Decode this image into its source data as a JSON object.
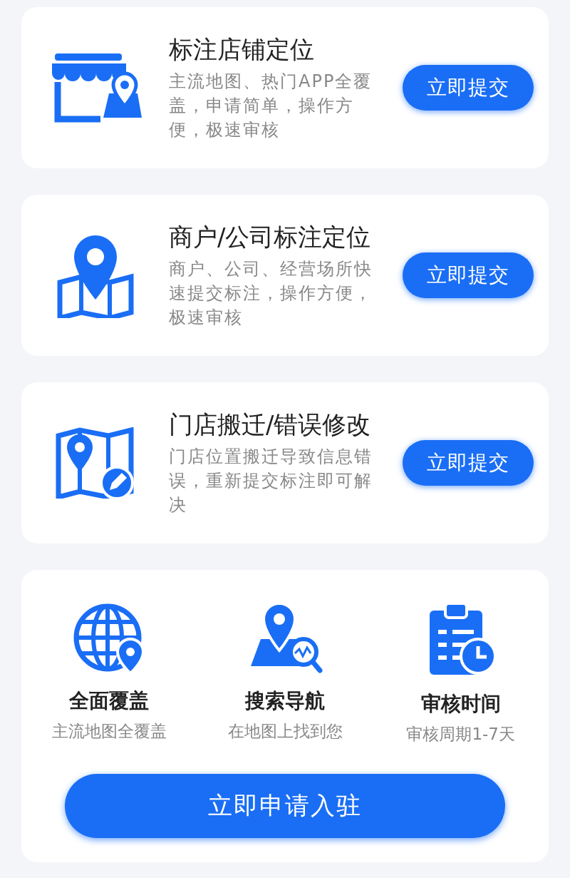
{
  "services": [
    {
      "kind": "shop",
      "title": "标注店铺定位",
      "description": "主流地图、热门APP全覆盖，申请简单，操作方便，极速审核",
      "button": "立即提交"
    },
    {
      "kind": "map-pin",
      "title": "商户/公司标注定位",
      "description": "商户、公司、经营场所快速提交标注，操作方便，极速审核",
      "button": "立即提交"
    },
    {
      "kind": "map-edit",
      "title": "门店搬迁/错误修改",
      "description": "门店位置搬迁导致信息错误，重新提交标注即可解决",
      "button": "立即提交"
    }
  ],
  "features": [
    {
      "kind": "globe",
      "title": "全面覆盖",
      "subtitle": "主流地图全覆盖"
    },
    {
      "kind": "search",
      "title": "搜索导航",
      "subtitle": "在地图上找到您"
    },
    {
      "kind": "clipboard",
      "title": "审核时间",
      "subtitle": "审核周期1-7天"
    }
  ],
  "apply_button": "立即申请入驻"
}
